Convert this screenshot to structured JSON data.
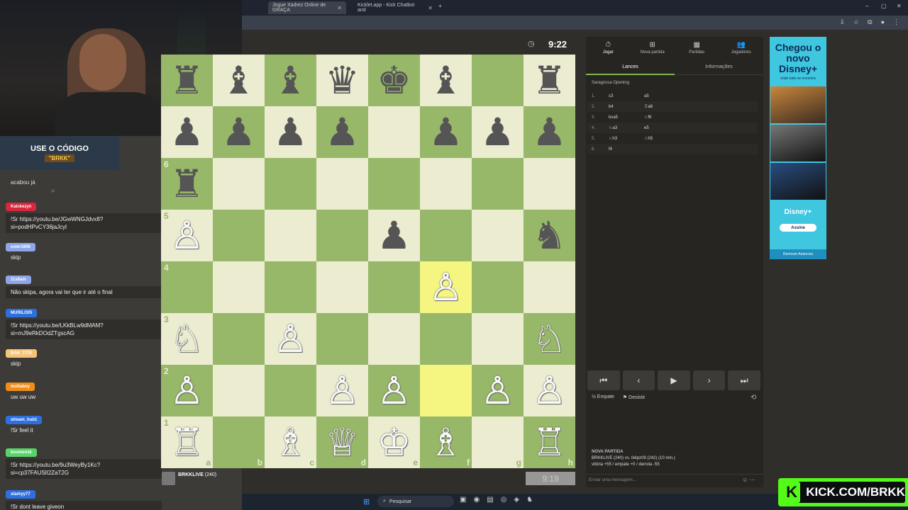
{
  "browser": {
    "tabs": [
      {
        "label": "Jogue Xadrez Online de GRAÇA",
        "active": true
      },
      {
        "label": "Kicklet.app - Kick Chatbot and",
        "active": false
      }
    ],
    "new_tab": "+",
    "window_controls": [
      "–",
      "▢",
      "✕"
    ]
  },
  "stream": {
    "promo_line1": "USE O CÓDIGO",
    "promo_line2": "\"BRKK\"",
    "chat_header": "acabou já",
    "chat": [
      {
        "user": "Kaickezyn",
        "color": "#d7263d",
        "message": "!Sr https://youtu.be/JGwWNGJdvx8?si=podHPvCY36jaJcyl"
      },
      {
        "user": "ester1808",
        "color": "#8ea6e8",
        "message": "skip"
      },
      {
        "user": "11x8am",
        "color": "#8ea6e8",
        "message": "Não skipa, agora vai ter que ir até o final"
      },
      {
        "user": "MURILO05",
        "color": "#2e6fe0",
        "message": "!Sr https://youtu.be/LKkBLw9dMAM?si=mJ9eRkDOdZTgscAG"
      },
      {
        "user": "BAH_7770",
        "color": "#f5c47a",
        "message": "skip"
      },
      {
        "user": "mottaboy",
        "color": "#f08c1a",
        "message": "uw uw uw"
      },
      {
        "user": "stream_hub1",
        "color": "#2e6fe0",
        "message": "!Sr feel it"
      },
      {
        "user": "boomenzk",
        "color": "#5bd36b",
        "message": "!Sr https://youtu.be/9u3WeyBy1Kc?si=cp37FAUSlI2ZaT2G"
      },
      {
        "user": "starkyy77",
        "color": "#2e6fe0",
        "message": "!Sr dont leave giveon"
      }
    ],
    "kick_banner": "KICK.COM/BRKK",
    "kick_logo": "K"
  },
  "game": {
    "top_clock": "9:22",
    "bottom_clock": "9:19",
    "bottom_player": "BRKKLIVE",
    "bottom_rating": "(240)",
    "board_colors": {
      "light": "#ebecd0",
      "dark": "#97b769",
      "highlight_light": "#f5f682",
      "highlight_dark": "#bbcb2b"
    },
    "files": [
      "a",
      "b",
      "c",
      "d",
      "e",
      "f",
      "g",
      "h"
    ],
    "ranks": [
      "1",
      "2",
      "3",
      "4",
      "5",
      "6"
    ],
    "highlight_squares": [
      "f4",
      "f2"
    ],
    "pieces": [
      {
        "sq": "a8",
        "p": "♜",
        "c": "b"
      },
      {
        "sq": "b8",
        "p": "♝",
        "c": "b"
      },
      {
        "sq": "c8",
        "p": "♝",
        "c": "b"
      },
      {
        "sq": "d8",
        "p": "♛",
        "c": "b"
      },
      {
        "sq": "e8",
        "p": "♚",
        "c": "b"
      },
      {
        "sq": "f8",
        "p": "♝",
        "c": "b"
      },
      {
        "sq": "h8",
        "p": "♜",
        "c": "b"
      },
      {
        "sq": "a7",
        "p": "♟",
        "c": "b"
      },
      {
        "sq": "b7",
        "p": "♟",
        "c": "b"
      },
      {
        "sq": "c7",
        "p": "♟",
        "c": "b"
      },
      {
        "sq": "d7",
        "p": "♟",
        "c": "b"
      },
      {
        "sq": "f7",
        "p": "♟",
        "c": "b"
      },
      {
        "sq": "g7",
        "p": "♟",
        "c": "b"
      },
      {
        "sq": "h7",
        "p": "♟",
        "c": "b"
      },
      {
        "sq": "a6",
        "p": "♜",
        "c": "b"
      },
      {
        "sq": "a5",
        "p": "♙",
        "c": "w"
      },
      {
        "sq": "e5",
        "p": "♟",
        "c": "b"
      },
      {
        "sq": "h5",
        "p": "♞",
        "c": "b"
      },
      {
        "sq": "f4",
        "p": "♙",
        "c": "w"
      },
      {
        "sq": "a3",
        "p": "♘",
        "c": "w"
      },
      {
        "sq": "c3",
        "p": "♙",
        "c": "w"
      },
      {
        "sq": "h3",
        "p": "♘",
        "c": "w"
      },
      {
        "sq": "a2",
        "p": "♙",
        "c": "w"
      },
      {
        "sq": "d2",
        "p": "♙",
        "c": "w"
      },
      {
        "sq": "e2",
        "p": "♙",
        "c": "w"
      },
      {
        "sq": "g2",
        "p": "♙",
        "c": "w"
      },
      {
        "sq": "h2",
        "p": "♙",
        "c": "w"
      },
      {
        "sq": "a1",
        "p": "♖",
        "c": "w"
      },
      {
        "sq": "c1",
        "p": "♗",
        "c": "w"
      },
      {
        "sq": "d1",
        "p": "♕",
        "c": "w"
      },
      {
        "sq": "e1",
        "p": "♔",
        "c": "w"
      },
      {
        "sq": "f1",
        "p": "♗",
        "c": "w"
      },
      {
        "sq": "h1",
        "p": "♖",
        "c": "w"
      }
    ]
  },
  "panel": {
    "nav": [
      {
        "icon": "⏱",
        "label": "Jogar",
        "active": true
      },
      {
        "icon": "⊞",
        "label": "Nova partida",
        "active": false
      },
      {
        "icon": "▦",
        "label": "Partidas",
        "active": false
      },
      {
        "icon": "👥",
        "label": "Jogadores",
        "active": false
      }
    ],
    "subtabs": [
      {
        "label": "Lances",
        "active": true
      },
      {
        "label": "Informações",
        "active": false
      }
    ],
    "opening": "Saragossa Opening",
    "moves": [
      {
        "n": "1.",
        "w": "c3",
        "b": "a5"
      },
      {
        "n": "2.",
        "w": "b4",
        "b": "♖a6"
      },
      {
        "n": "3.",
        "w": "bxa5",
        "b": "♘f6"
      },
      {
        "n": "4.",
        "w": "♘a3",
        "b": "e5"
      },
      {
        "n": "5.",
        "w": "♘h3",
        "b": "♘h5"
      },
      {
        "n": "6.",
        "w": "f4",
        "b": ""
      }
    ],
    "controls": [
      "⏮",
      "‹",
      "▶",
      "›",
      "⏭"
    ],
    "draw_label": "Empate",
    "resign_label": "Desistir",
    "new_game_title": "NOVA PARTIDA",
    "new_game_line1": "BRKKLIVE (240) vs. felipz09 (242) (10 min.)",
    "new_game_line2": "vitória +55 / empate +0 / derrota -55",
    "message_placeholder": "Enviar uma mensagem..."
  },
  "ad": {
    "title": "Chegou o novo Disney+",
    "subtitle": "onde tudo se encontra",
    "logo": "Disney+",
    "button": "Assine",
    "remove": "Remover Anúncios",
    "bg_color": "#3fc7e0"
  },
  "taskbar": {
    "search": "Pesquisar"
  }
}
